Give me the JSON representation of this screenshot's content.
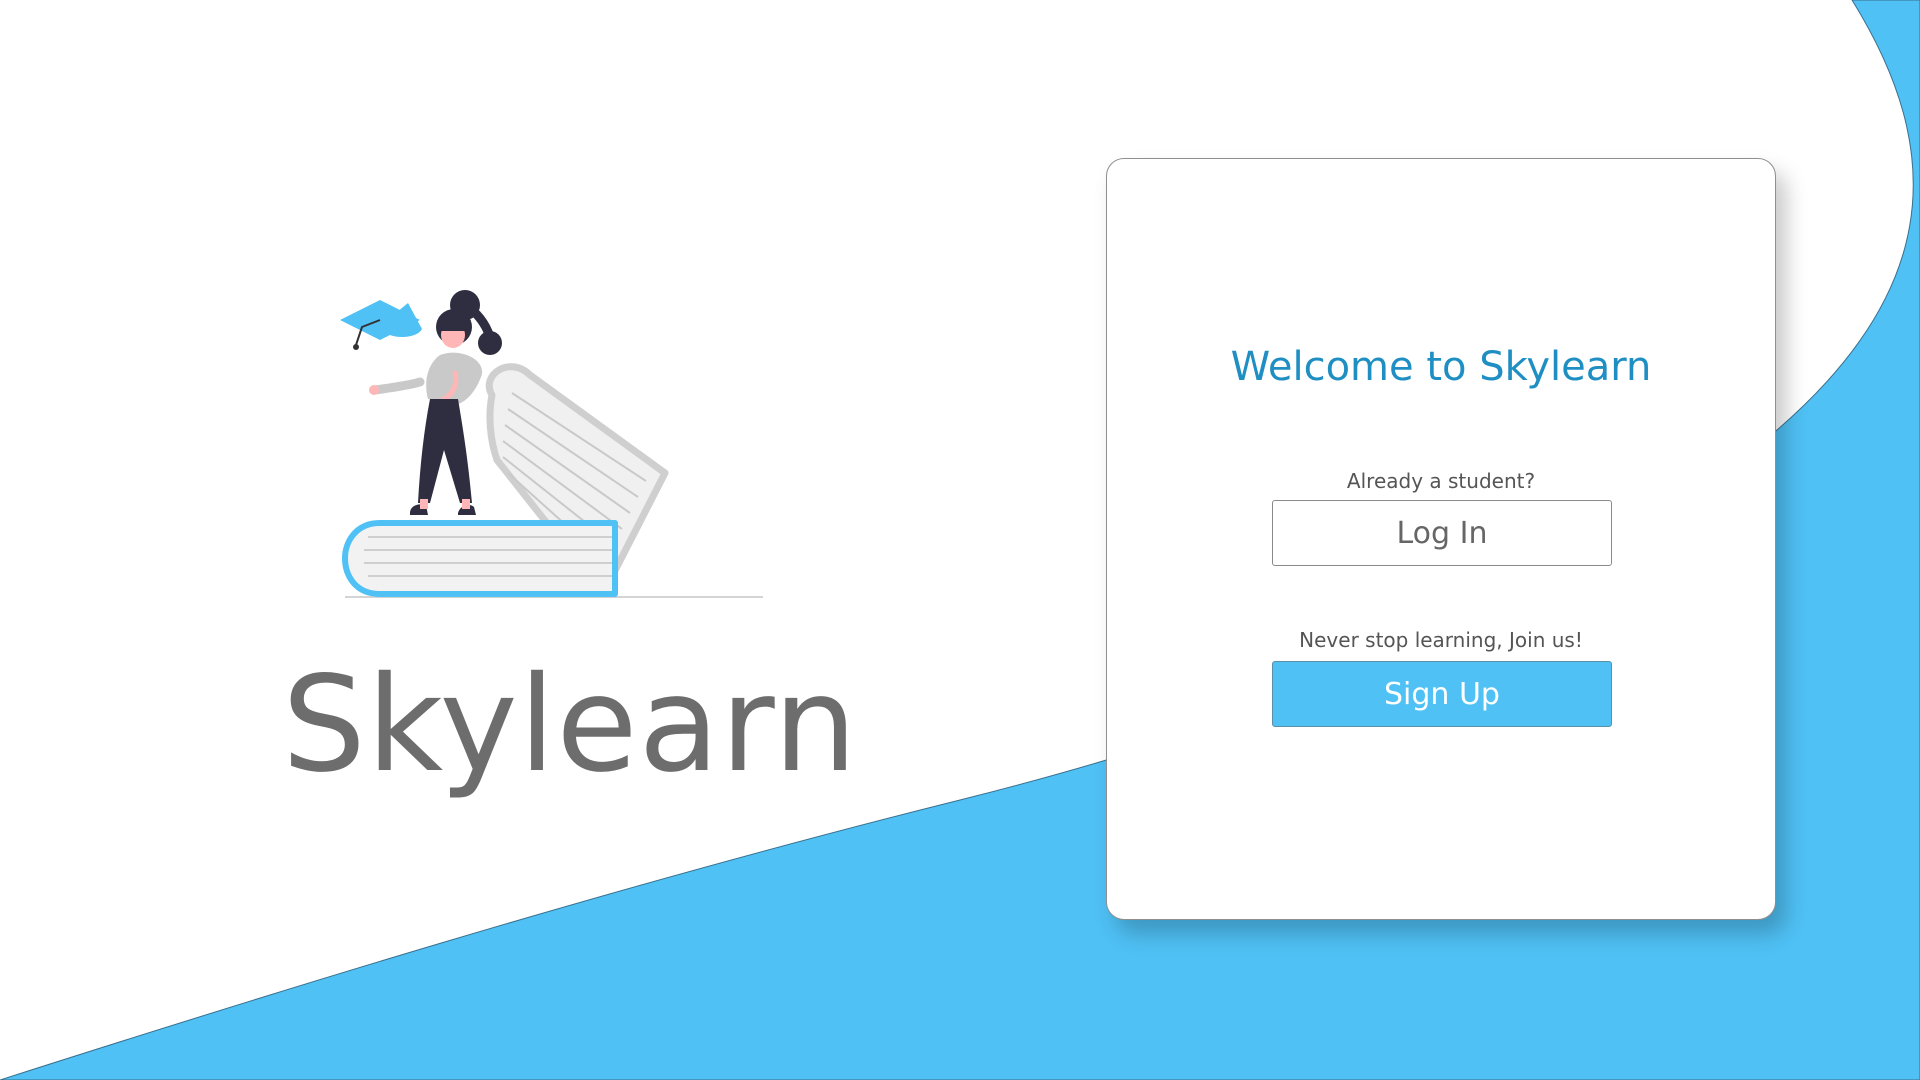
{
  "brand": {
    "name": "Skylearn"
  },
  "welcome_card": {
    "title": "Welcome to Skylearn",
    "login_prompt": "Already a student?",
    "login_label": "Log In",
    "signup_prompt": "Never stop learning, Join us!",
    "signup_label": "Sign Up"
  },
  "illustration": {
    "subject": "student-standing-on-books-icon"
  },
  "colors": {
    "accent_blue": "#4fc1f5",
    "title_blue": "#1f8fc3",
    "text_gray": "#6d6d6d",
    "card_background": "#ffffff"
  }
}
